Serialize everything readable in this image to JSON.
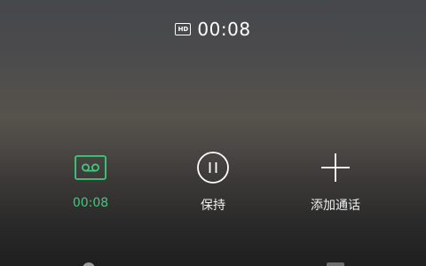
{
  "header": {
    "hd_badge": "HD",
    "call_timer": "00:08"
  },
  "controls": [
    {
      "id": "record",
      "label": "00:08",
      "icon": "cassette-icon",
      "color": "#3fca7c"
    },
    {
      "id": "hold",
      "label": "保持",
      "icon": "pause-circle-icon",
      "color": "#ffffff"
    },
    {
      "id": "add_call",
      "label": "添加通话",
      "icon": "plus-icon",
      "color": "#ffffff"
    }
  ]
}
